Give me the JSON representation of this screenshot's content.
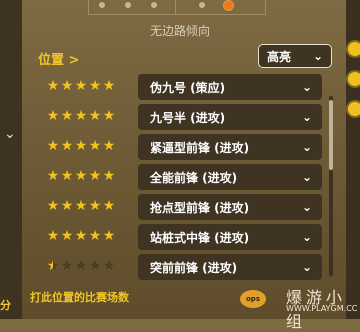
{
  "header": {
    "role_title": "无边路倾向"
  },
  "position_link": "位置 >",
  "style_dropdown": {
    "label": "高亮"
  },
  "roles": [
    {
      "stars": 5,
      "name": "伪九号 (策应)"
    },
    {
      "stars": 5,
      "name": "九号半 (进攻)"
    },
    {
      "stars": 5,
      "name": "紧逼型前锋 (进攻)"
    },
    {
      "stars": 5,
      "name": "全能前锋 (进攻)"
    },
    {
      "stars": 5,
      "name": "抢点型前锋 (进攻)"
    },
    {
      "stars": 5,
      "name": "站桩式中锋 (进攻)"
    },
    {
      "stars": 0.5,
      "name": "突前前锋 (进攻)"
    }
  ],
  "footer": {
    "match_count_label": "打此位置的比赛场数",
    "left_partial": "分"
  },
  "watermark": {
    "badge": "ops",
    "cn": "爆游小组",
    "url": "WWW.PLAYGM.CC"
  },
  "colors": {
    "star": "#f3c21b",
    "accent": "#f2c626",
    "pill_bg": "#3f3322"
  }
}
